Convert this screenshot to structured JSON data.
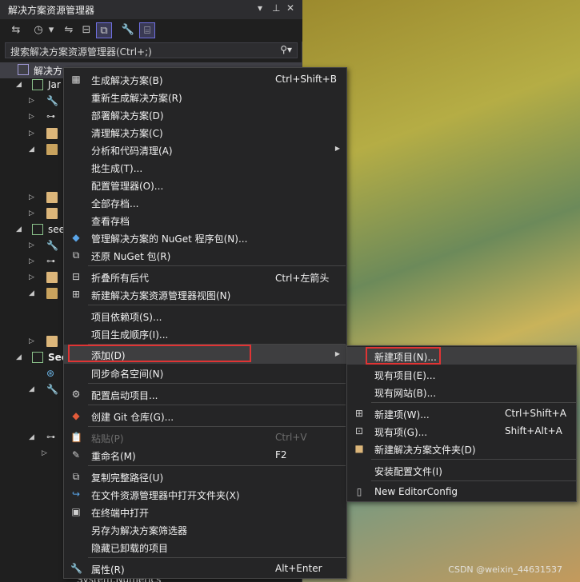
{
  "panel": {
    "title": "解决方案资源管理器",
    "search_placeholder": "搜索解决方案资源管理器(Ctrl+;)",
    "tree": [
      {
        "label": "解决方"
      },
      {
        "label": "Jar"
      },
      {
        "label": "see"
      },
      {
        "label": "See"
      },
      {
        "label": "System.Numerics"
      }
    ]
  },
  "menu": {
    "items": [
      {
        "label": "生成解决方案(B)",
        "shortcut": "Ctrl+Shift+B"
      },
      {
        "label": "重新生成解决方案(R)",
        "shortcut": ""
      },
      {
        "label": "部署解决方案(D)",
        "shortcut": ""
      },
      {
        "label": "清理解决方案(C)",
        "shortcut": ""
      },
      {
        "label": "分析和代码清理(A)",
        "shortcut": ""
      },
      {
        "label": "批生成(T)...",
        "shortcut": ""
      },
      {
        "label": "配置管理器(O)...",
        "shortcut": ""
      },
      {
        "label": "全部存档...",
        "shortcut": ""
      },
      {
        "label": "查看存档",
        "shortcut": ""
      },
      {
        "label": "管理解决方案的 NuGet 程序包(N)...",
        "shortcut": ""
      },
      {
        "label": "还原 NuGet 包(R)",
        "shortcut": ""
      },
      {
        "label": "折叠所有后代",
        "shortcut": "Ctrl+左箭头"
      },
      {
        "label": "新建解决方案资源管理器视图(N)",
        "shortcut": ""
      },
      {
        "label": "项目依赖项(S)...",
        "shortcut": ""
      },
      {
        "label": "项目生成顺序(I)...",
        "shortcut": ""
      },
      {
        "label": "添加(D)",
        "shortcut": ""
      },
      {
        "label": "同步命名空间(N)",
        "shortcut": ""
      },
      {
        "label": "配置启动项目...",
        "shortcut": ""
      },
      {
        "label": "创建 Git 仓库(G)...",
        "shortcut": ""
      },
      {
        "label": "粘贴(P)",
        "shortcut": "Ctrl+V"
      },
      {
        "label": "重命名(M)",
        "shortcut": "F2"
      },
      {
        "label": "复制完整路径(U)",
        "shortcut": ""
      },
      {
        "label": "在文件资源管理器中打开文件夹(X)",
        "shortcut": ""
      },
      {
        "label": "在终端中打开",
        "shortcut": ""
      },
      {
        "label": "另存为解决方案筛选器",
        "shortcut": ""
      },
      {
        "label": "隐藏已卸载的项目",
        "shortcut": ""
      },
      {
        "label": "属性(R)",
        "shortcut": "Alt+Enter"
      }
    ]
  },
  "submenu": {
    "items": [
      {
        "label": "新建项目(N)...",
        "shortcut": ""
      },
      {
        "label": "现有项目(E)...",
        "shortcut": ""
      },
      {
        "label": "现有网站(B)...",
        "shortcut": ""
      },
      {
        "label": "新建项(W)...",
        "shortcut": "Ctrl+Shift+A"
      },
      {
        "label": "现有项(G)...",
        "shortcut": "Shift+Alt+A"
      },
      {
        "label": "新建解决方案文件夹(D)",
        "shortcut": ""
      },
      {
        "label": "安装配置文件(I)",
        "shortcut": ""
      },
      {
        "label": "New EditorConfig",
        "shortcut": ""
      }
    ]
  },
  "watermark": "CSDN @weixin_44631537",
  "colors": {
    "highlight_box": "#e03434",
    "menu_bg": "#252526",
    "panel_bg": "#1f1f1f"
  }
}
